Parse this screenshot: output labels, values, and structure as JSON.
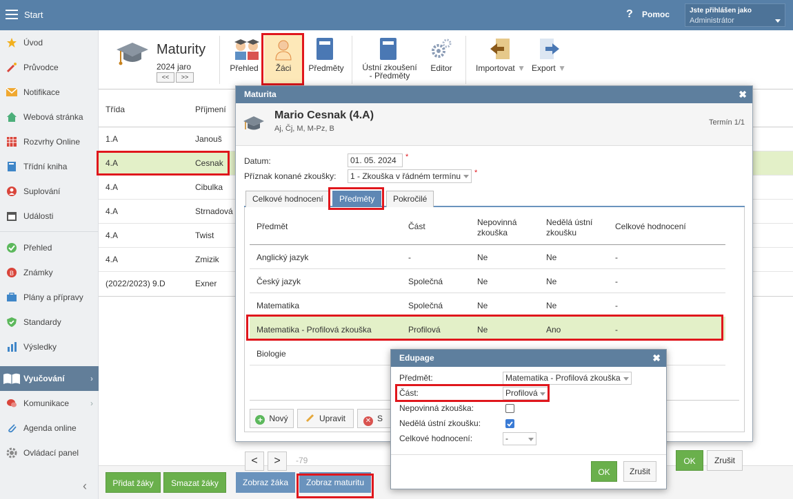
{
  "topbar": {
    "menu_label": "Start",
    "help_label": "Pomoc",
    "login_title": "Jste přihlášen jako",
    "login_user": "Administrátor"
  },
  "sidebar": {
    "items": [
      {
        "label": "Úvod"
      },
      {
        "label": "Průvodce"
      },
      {
        "label": "Notifikace"
      },
      {
        "label": "Webová stránka"
      },
      {
        "label": "Rozvrhy Online"
      },
      {
        "label": "Třídní kniha"
      },
      {
        "label": "Suplování"
      },
      {
        "label": "Události"
      },
      {
        "label": "Přehled"
      },
      {
        "label": "Známky"
      },
      {
        "label": "Plány a přípravy"
      },
      {
        "label": "Standardy"
      },
      {
        "label": "Výsledky"
      },
      {
        "label": "Vyučování"
      },
      {
        "label": "Komunikace"
      },
      {
        "label": "Agenda online"
      },
      {
        "label": "Ovládací panel"
      }
    ]
  },
  "toolbar": {
    "title": "Maturity",
    "period": "2024 jaro",
    "prev": "<<",
    "next": ">>",
    "buttons": {
      "prehled": "Přehled",
      "zaci": "Žáci",
      "predmety": "Předměty",
      "ustni1": "Ústní zkoušení",
      "ustni2": "- Předměty",
      "editor": "Editor",
      "import": "Importovat",
      "export": "Export"
    }
  },
  "students_table": {
    "headers": {
      "trida": "Třída",
      "prijmeni": "Příjmení"
    },
    "rows": [
      {
        "trida": "1.A",
        "prijmeni": "Janouš"
      },
      {
        "trida": "4.A",
        "prijmeni": "Cesnak"
      },
      {
        "trida": "4.A",
        "prijmeni": "Cibulka"
      },
      {
        "trida": "4.A",
        "prijmeni": "Strnadová"
      },
      {
        "trida": "4.A",
        "prijmeni": "Twist"
      },
      {
        "trida": "4.A",
        "prijmeni": "Zmizik"
      },
      {
        "trida": "(2022/2023) 9.D",
        "prijmeni": "Exner"
      }
    ]
  },
  "bottom": {
    "pridat": "Přidat žáky",
    "smazat": "Smazat žáky",
    "zobraz_zaka": "Zobraz žáka",
    "zobraz_maturitu": "Zobraz maturitu"
  },
  "modal": {
    "title": "Maturita",
    "student_name": "Mario Cesnak (4.A)",
    "subjects": "Aj, Čj, M, M-Pz, B",
    "term": "Termín 1/1",
    "datum_label": "Datum:",
    "datum_value": "01. 05. 2024",
    "priznak_label": "Příznak konané zkoušky:",
    "priznak_value": "1 - Zkouška v řádném termínu",
    "required": "*",
    "tabs": {
      "celkove": "Celkové hodnocení",
      "predmety": "Předměty",
      "pokrocile": "Pokročilé"
    },
    "table": {
      "headers": {
        "predmet": "Předmět",
        "cast": "Část",
        "nepovinna1": "Nepovinná",
        "nepovinna2": "zkouška",
        "nedela1": "Nedělá ústní",
        "nedela2": "zkoušku",
        "celkove": "Celkové hodnocení"
      },
      "rows": [
        {
          "predmet": "Anglický jazyk",
          "cast": "-",
          "nepovinna": "Ne",
          "nedela": "Ne",
          "celkove": "-"
        },
        {
          "predmet": "Český jazyk",
          "cast": "Společná",
          "nepovinna": "Ne",
          "nedela": "Ne",
          "celkove": "-"
        },
        {
          "predmet": "Matematika",
          "cast": "Společná",
          "nepovinna": "Ne",
          "nedela": "Ne",
          "celkove": "-"
        },
        {
          "predmet": "Matematika - Profilová zkouška",
          "cast": "Profilová",
          "nepovinna": "Ne",
          "nedela": "Ano",
          "celkove": "-"
        },
        {
          "predmet": "Biologie",
          "cast": "",
          "nepovinna": "",
          "nedela": "",
          "celkove": ""
        }
      ]
    },
    "actions": {
      "novy": "Nový",
      "upravit": "Upravit",
      "smazat_partial": "S"
    },
    "nav": {
      "prev": "<",
      "next": ">",
      "id": "-79"
    },
    "ok": "OK",
    "zrusit": "Zrušit"
  },
  "dialog": {
    "title": "Edupage",
    "predmet_label": "Předmět:",
    "predmet_value": "Matematika - Profilová zkouška",
    "cast_label": "Část:",
    "cast_value": "Profilová",
    "nepovinna_label": "Nepovinná zkouška:",
    "nedela_label": "Nedělá ústní zkoušku:",
    "celkove_label": "Celkové hodnocení:",
    "celkove_value": "-",
    "ok": "OK",
    "zrusit": "Zrušit",
    "nepovinna_checked": false,
    "nedela_checked": true
  },
  "colors": {
    "topbar": "#5780a8",
    "accent_blue": "#5e7f9e",
    "green": "#6ab04c",
    "highlight": "#e3f0c8",
    "red": "#e0161c"
  }
}
